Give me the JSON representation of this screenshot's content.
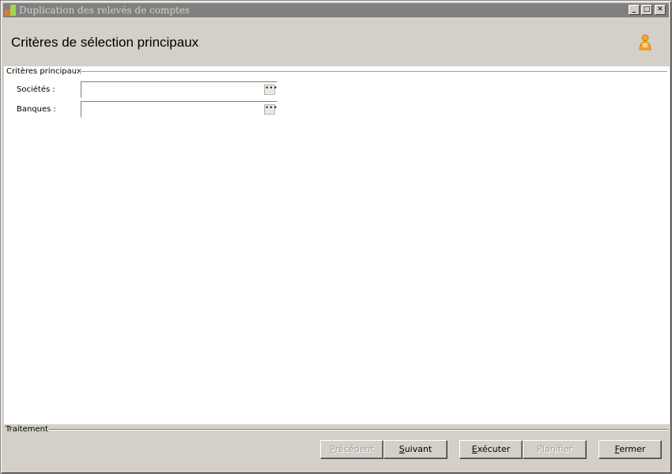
{
  "window": {
    "title": "Duplication des relevés de comptes",
    "minimize_glyph": "_",
    "maximize_glyph": "□",
    "close_glyph": "✕"
  },
  "header": {
    "title": "Critères de sélection principaux",
    "icon": "user-icon"
  },
  "criteria_group": {
    "legend": "Critères principaux",
    "fields": [
      {
        "label": "Sociétés :",
        "value": "",
        "button_glyph": "•••"
      },
      {
        "label": "Banques :",
        "value": "",
        "button_glyph": "•••"
      }
    ]
  },
  "footer": {
    "legend": "Traitement",
    "buttons": {
      "previous": {
        "mnemonic": "P",
        "rest": "récédent",
        "enabled": false
      },
      "next": {
        "mnemonic": "S",
        "rest": "uivant",
        "enabled": true
      },
      "execute": {
        "mnemonic": "E",
        "rest": "xécuter",
        "enabled": true
      },
      "schedule": {
        "label": "Planifier",
        "enabled": false
      },
      "close": {
        "mnemonic": "F",
        "rest": "ermer",
        "enabled": true
      }
    }
  },
  "colors": {
    "titlebar_inactive": "#808080",
    "window_face": "#d4d0c8",
    "content_bg": "#ffffff",
    "user_icon": "#f5a623"
  }
}
